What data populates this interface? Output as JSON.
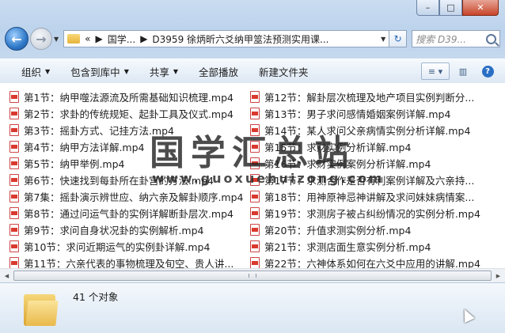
{
  "address": {
    "crumbs": [
      "国学...",
      "D3959 徐炳昕六爻纳甲筮法预测实用课..."
    ],
    "overflow": "«",
    "search_placeholder": "搜索 D39..."
  },
  "toolbar": {
    "organize": "组织",
    "include": "包含到库中",
    "share": "共享",
    "play_all": "全部播放",
    "new_folder": "新建文件夹"
  },
  "files": {
    "left": [
      "第1节：纳甲噬法源流及所需基础知识梳理.mp4",
      "第2节：求卦的传统规矩、起卦工具及仪式.mp4",
      "第3节：摇卦方式、记挂方法.mp4",
      "第4节：纳甲方法详解.mp4",
      "第5节：纳甲举例.mp4",
      "第6节：快速找到每卦所在卦宫的方法.mp4",
      "第7集：摇卦演示辨世应、纳六亲及解卦顺序.mp4",
      "第8节：通过问运气卦的实例详解断卦层次.mp4",
      "第9节：求问自身状况卦的实例解析.mp4",
      "第10节：求问近期运气的实例卦详解.mp4",
      "第11节：六亲代表的事物梳理及旬空、贵人讲..."
    ],
    "right": [
      "第12节：解卦层次梳理及地产项目实例判断分...",
      "第13节：男子求问感情婚姻案例详解.mp4",
      "第14节：某人求问父亲病情实例分析详解.mp4",
      "第15节：求财实例分析详解.mp4",
      "第16节：求财实例案例分析详解.mp4",
      "第17节：求测合作是否有利案例详解及六亲持...",
      "第18节：用神原神忌神讲解及求问妹妹病情案...",
      "第19节：求测房子被占纠纷情况的实例分析.mp4",
      "第20节：升值求测实例分析.mp4",
      "第21节：求测店面生意实例分析.mp4",
      "第22节：六神体系如何在六爻中应用的讲解.mp4"
    ]
  },
  "watermark": {
    "title": "国学汇总站",
    "url": "www.guoxuehuizong.com"
  },
  "status": {
    "count_text": "41 个对象"
  }
}
